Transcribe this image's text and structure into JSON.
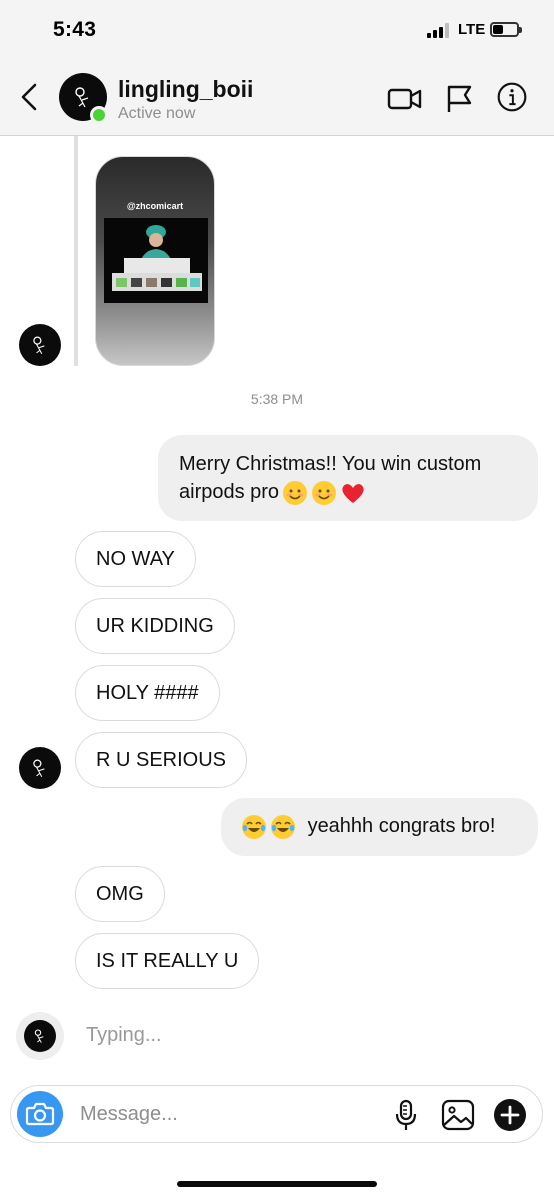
{
  "status_bar": {
    "time": "5:43",
    "network": "LTE",
    "battery_level": 0.45,
    "signal_bars": 3
  },
  "header": {
    "username": "lingling_boii",
    "status": "Active now",
    "icons": [
      "back-chevron-icon",
      "video-call-icon",
      "flag-icon",
      "info-icon"
    ]
  },
  "shared_post": {
    "handle": "@zhcomicart"
  },
  "chat": {
    "timestamp": "5:38 PM",
    "messages": [
      {
        "from": "me",
        "text": "Merry Christmas!! You win custom airpods pro",
        "emoji": [
          "smiling-face-icon",
          "smiling-face-icon",
          "red-heart-icon"
        ]
      },
      {
        "from": "them",
        "text": "NO WAY"
      },
      {
        "from": "them",
        "text": "UR KIDDING"
      },
      {
        "from": "them",
        "text": "HOLY ####"
      },
      {
        "from": "them",
        "text": "R U SERIOUS"
      },
      {
        "from": "me",
        "text": "yeahhh congrats bro!",
        "emoji_prefix": [
          "tears-of-joy-icon",
          "tears-of-joy-icon"
        ]
      },
      {
        "from": "them",
        "text": "OMG"
      },
      {
        "from": "them",
        "text": "IS IT REALLY U"
      }
    ],
    "typing": "Typing..."
  },
  "composer": {
    "placeholder": "Message...",
    "icons": [
      "camera-icon",
      "microphone-icon",
      "gallery-icon",
      "plus-icon"
    ]
  },
  "colors": {
    "accent_blue": "#3897f0",
    "online_green": "#4cd137",
    "outgoing_bubble": "#efefef",
    "incoming_border": "#dbdbdb"
  }
}
